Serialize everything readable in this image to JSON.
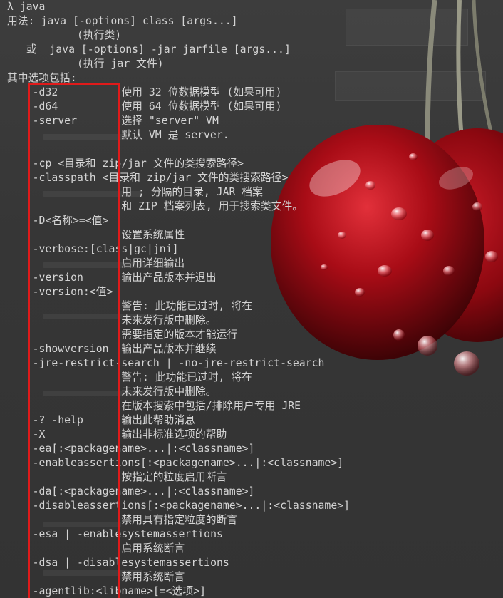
{
  "terminal": {
    "lines": [
      "λ java",
      "用法: java [-options] class [args...]",
      "           (执行类)",
      "   或  java [-options] -jar jarfile [args...]",
      "           (执行 jar 文件)",
      "其中选项包括:",
      "    -d32          使用 32 位数据模型 (如果可用)",
      "    -d64          使用 64 位数据模型 (如果可用)",
      "    -server       选择 \"server\" VM",
      "                  默认 VM 是 server.",
      "",
      "    -cp <目录和 zip/jar 文件的类搜索路径>",
      "    -classpath <目录和 zip/jar 文件的类搜索路径>",
      "                  用 ; 分隔的目录, JAR 档案",
      "                  和 ZIP 档案列表, 用于搜索类文件。",
      "    -D<名称>=<值>",
      "                  设置系统属性",
      "    -verbose:[class|gc|jni]",
      "                  启用详细输出",
      "    -version      输出产品版本并退出",
      "    -version:<值>",
      "                  警告: 此功能已过时, 将在",
      "                  未来发行版中删除。",
      "                  需要指定的版本才能运行",
      "    -showversion  输出产品版本并继续",
      "    -jre-restrict-search | -no-jre-restrict-search",
      "                  警告: 此功能已过时, 将在",
      "                  未来发行版中删除。",
      "                  在版本搜索中包括/排除用户专用 JRE",
      "    -? -help      输出此帮助消息",
      "    -X            输出非标准选项的帮助",
      "    -ea[:<packagename>...|:<classname>]",
      "    -enableassertions[:<packagename>...|:<classname>]",
      "                  按指定的粒度启用断言",
      "    -da[:<packagename>...|:<classname>]",
      "    -disableassertions[:<packagename>...|:<classname>]",
      "                  禁用具有指定粒度的断言",
      "    -esa | -enablesystemassertions",
      "                  启用系统断言",
      "    -dsa | -disablesystemassertions",
      "                  禁用系统断言",
      "    -agentlib:<libname>[=<选项>]"
    ]
  },
  "colors": {
    "background": "#3a3a3a",
    "text": "#d4d4d4",
    "highlight_border": "#e01a1a",
    "cherry": "#b0101a"
  }
}
